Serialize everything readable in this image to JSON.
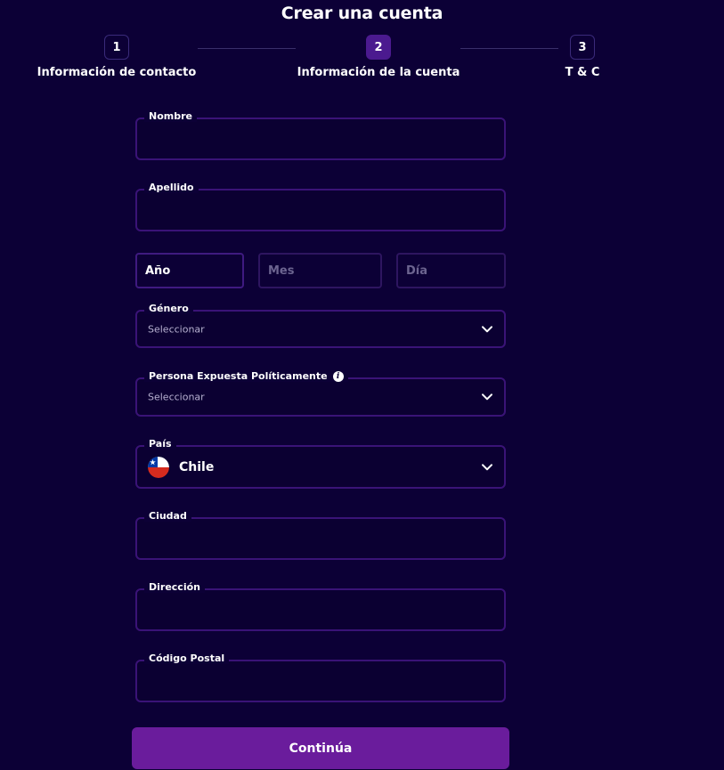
{
  "title": "Crear una cuenta",
  "steps": [
    {
      "number": "1",
      "label": "Información de contacto",
      "active": false
    },
    {
      "number": "2",
      "label": "Información de la cuenta",
      "active": true
    },
    {
      "number": "3",
      "label": "T & C",
      "active": false
    }
  ],
  "form": {
    "first_name": {
      "label": "Nombre",
      "value": ""
    },
    "last_name": {
      "label": "Apellido",
      "value": ""
    },
    "birth": {
      "year": "Año",
      "month": "Mes",
      "day": "Día"
    },
    "gender": {
      "label": "Género",
      "value": "Seleccionar"
    },
    "pep": {
      "label": "Persona Expuesta Políticamente",
      "value": "Seleccionar",
      "info_icon": "info-icon"
    },
    "country": {
      "label": "País",
      "value": "Chile",
      "flag_icon": "chile-flag-icon"
    },
    "city": {
      "label": "Ciudad",
      "value": ""
    },
    "address": {
      "label": "Dirección",
      "value": ""
    },
    "postal_code": {
      "label": "Código Postal",
      "value": ""
    }
  },
  "submit_label": "Continúa",
  "colors": {
    "background": "#0c0036",
    "field_border": "#3a1377",
    "active_step": "#4b1a8f",
    "button": "#6a1c9c"
  }
}
